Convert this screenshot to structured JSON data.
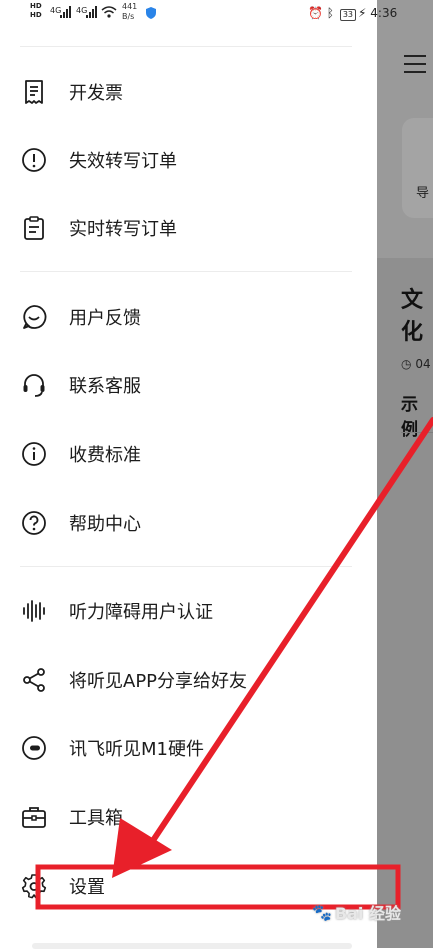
{
  "status_bar": {
    "network_speed_value": "441",
    "network_speed_unit": "B/s",
    "battery": "33",
    "time": "4:36",
    "hd1": "HD",
    "hd2": "HD",
    "signal1": "4G",
    "signal2": "4G"
  },
  "menu": {
    "items": [
      {
        "label": "开发票",
        "icon": "receipt-icon"
      },
      {
        "label": "失效转写订单",
        "icon": "alert-circle-icon"
      },
      {
        "label": "实时转写订单",
        "icon": "clipboard-icon"
      },
      {
        "label": "用户反馈",
        "icon": "feedback-chat-icon"
      },
      {
        "label": "联系客服",
        "icon": "headset-icon"
      },
      {
        "label": "收费标准",
        "icon": "info-icon"
      },
      {
        "label": "帮助中心",
        "icon": "help-icon"
      },
      {
        "label": "听力障碍用户认证",
        "icon": "soundwave-icon"
      },
      {
        "label": "将听见APP分享给好友",
        "icon": "share-icon"
      },
      {
        "label": "讯飞听见M1硬件",
        "icon": "device-icon"
      },
      {
        "label": "工具箱",
        "icon": "toolbox-icon"
      },
      {
        "label": "设置",
        "icon": "gear-icon"
      }
    ]
  },
  "background_page": {
    "card_text": "导",
    "title": "文化",
    "time": "04",
    "item_text": "示例"
  },
  "watermark": {
    "text": "Bai 经验"
  },
  "colors": {
    "annotation_red": "#e8202a",
    "overlay_gray": "#8f8f8f"
  }
}
